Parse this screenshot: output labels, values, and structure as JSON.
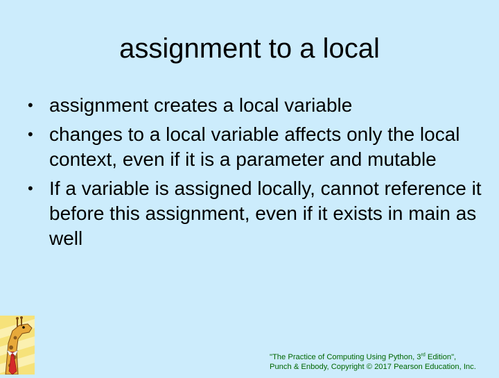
{
  "slide": {
    "title": "assignment to a local",
    "bullets": [
      {
        "marker": "•",
        "text": "assignment creates a local variable"
      },
      {
        "marker": "•",
        "text": "changes to a local variable affects only the local context, even if it is a parameter and mutable"
      },
      {
        "marker": "•",
        "text": "If a variable is assigned locally, cannot reference it before this assignment, even if it exists in main as well"
      }
    ],
    "footer": {
      "line1_start": "\"The Practice of Computing Using Python, 3",
      "line1_sup": "rd",
      "line1_end": " Edition\",",
      "line2": "Punch & Enbody, Copyright © 2017 Pearson Education, Inc."
    }
  },
  "colors": {
    "background": "#ccecfc",
    "footer_text": "#006600"
  },
  "icons": {
    "logo": "giraffe-with-tie-logo"
  }
}
